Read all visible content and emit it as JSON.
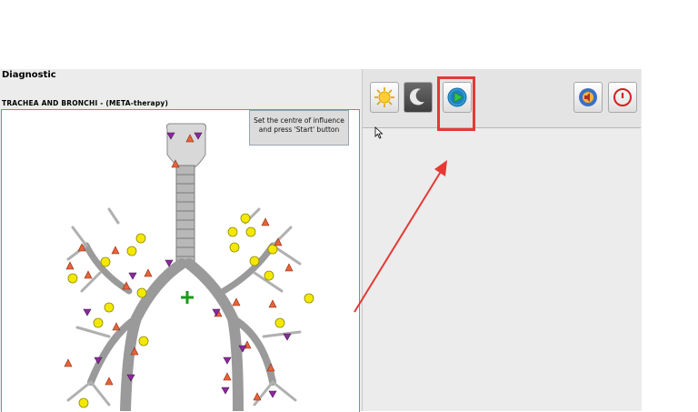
{
  "window": {
    "title": "Diagnostic",
    "subtitle": "TRACHEA AND BRONCHI - (META-therapy)"
  },
  "hint": {
    "text": "Set the centre of influence and press 'Start' button"
  },
  "toolbar": {
    "buttons": [
      {
        "name": "day-mode",
        "icon": "sun-icon"
      },
      {
        "name": "night-mode",
        "icon": "moon-icon"
      },
      {
        "name": "start",
        "icon": "play-icon"
      },
      {
        "name": "audio",
        "icon": "speaker-icon"
      },
      {
        "name": "power",
        "icon": "power-icon"
      }
    ]
  },
  "colors": {
    "highlight": "#e53935",
    "triangle_orange": "#e8623a",
    "triangle_purple": "#8a2a9a",
    "hexagon_yellow": "#f5e800",
    "marker_green": "#1a9a1a"
  }
}
